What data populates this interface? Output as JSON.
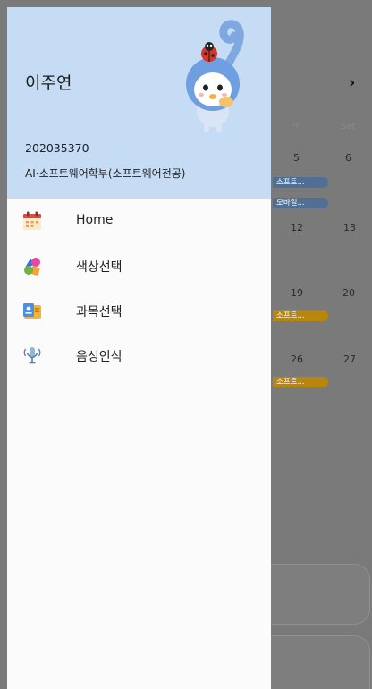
{
  "background": {
    "next_arrow": "›",
    "weekdays": [
      "Fri",
      "Sat"
    ],
    "weeks": [
      {
        "fri": "5",
        "sat": "6",
        "chips": [
          {
            "label": "소프트...",
            "color": "#4f6f95"
          },
          {
            "label": "모바일...",
            "color": "#4f6f95"
          }
        ]
      },
      {
        "fri": "12",
        "sat": "13",
        "chips": []
      },
      {
        "fri": "19",
        "sat": "20",
        "chips": [
          {
            "label": "소프트...",
            "color": "#b8860b"
          }
        ]
      },
      {
        "fri": "26",
        "sat": "27",
        "chips": [
          {
            "label": "소프트...",
            "color": "#b8860b"
          }
        ]
      }
    ]
  },
  "drawer": {
    "header": {
      "name": "이주연",
      "student_id": "202035370",
      "department": "AI·소프트웨어학부(소프트웨어전공)"
    },
    "menu": [
      {
        "label": "Home",
        "icon": "calendar-icon"
      },
      {
        "label": "색상선택",
        "icon": "color-palette-icon"
      },
      {
        "label": "과목선택",
        "icon": "subject-folder-icon"
      },
      {
        "label": "음성인식",
        "icon": "microphone-icon"
      }
    ]
  },
  "colors": {
    "header_bg": "#c6dcf4",
    "drawer_bg": "#fbfbfb",
    "scrim": "#7a7a7a"
  }
}
